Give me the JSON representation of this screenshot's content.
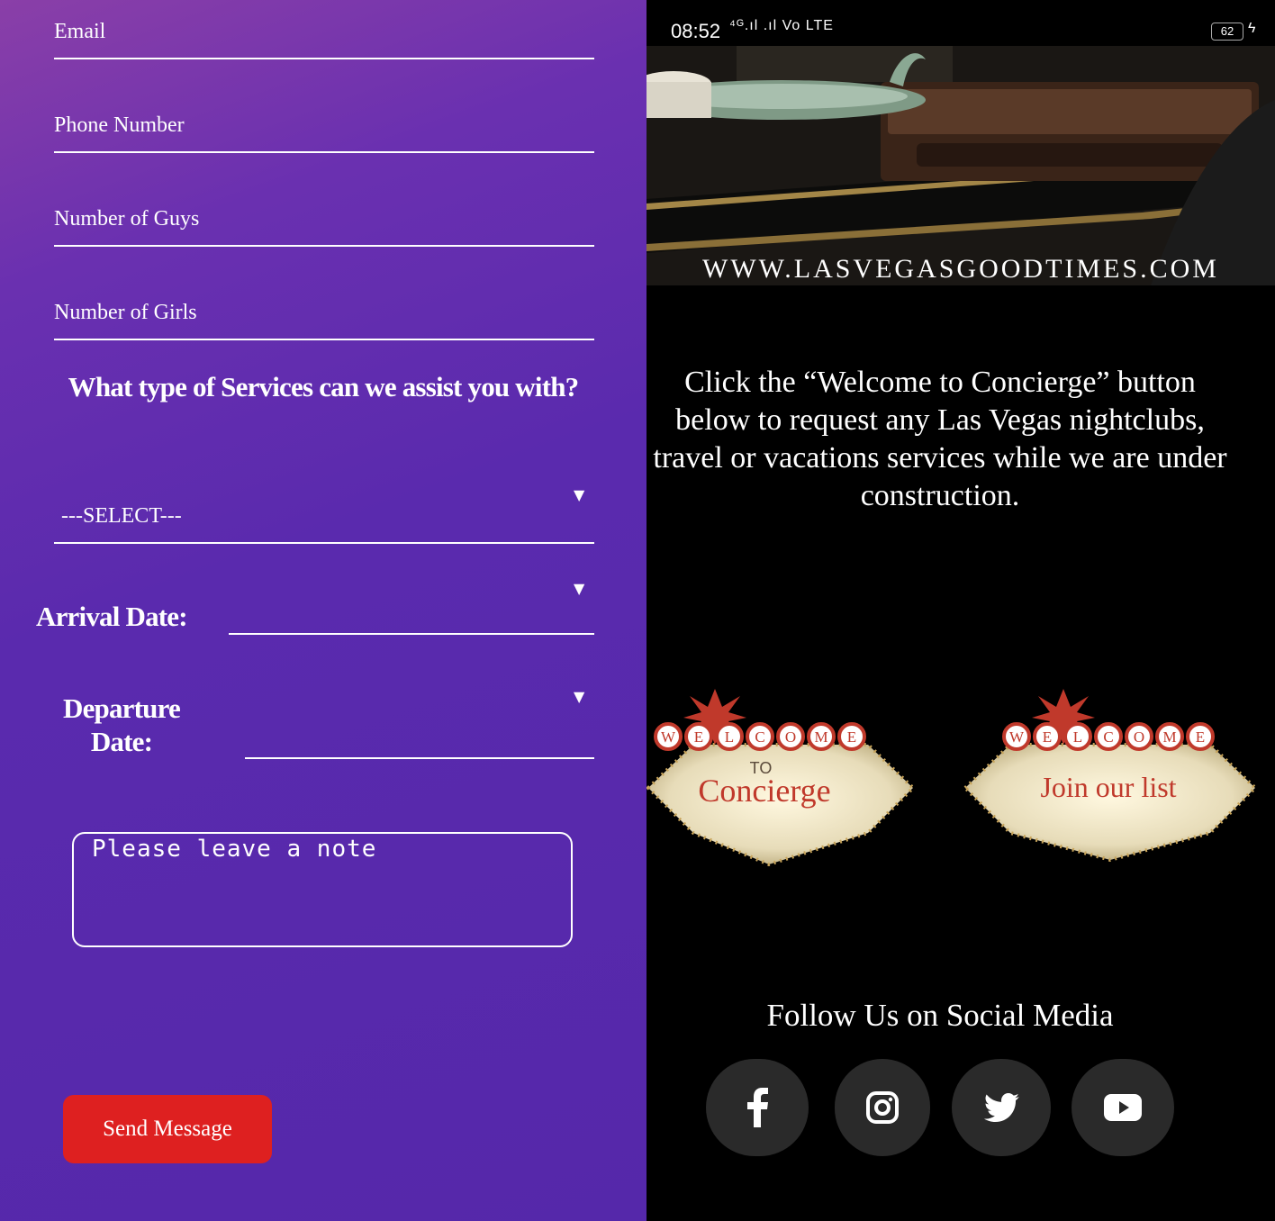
{
  "form": {
    "email_placeholder": "Email",
    "phone_placeholder": "Phone Number",
    "guys_placeholder": "Number of Guys",
    "girls_placeholder": "Number of Girls",
    "services_question": "What type of Services can we assist you with?",
    "services_select_value": "---SELECT---",
    "arrival_label": "Arrival Date:",
    "departure_label_line1": "Departure",
    "departure_label_line2": "Date:",
    "note_placeholder": "Please leave a note",
    "send_button": "Send Message"
  },
  "status_bar": {
    "time": "08:52",
    "network": "⁴ᴳ.ıl .ıl Vo LTE",
    "battery": "62"
  },
  "site": {
    "url": "WWW.LASVEGASGOODTIMES.COM",
    "message": "Click the “Welcome to Concierge” button below to request any Las Vegas nightclubs, travel or vacations services while we are under construction.",
    "concierge_sign": {
      "welcome_letters": [
        "W",
        "E",
        "L",
        "C",
        "O",
        "M",
        "E"
      ],
      "small": "TO",
      "main": "Concierge"
    },
    "join_sign": {
      "welcome_letters": [
        "W",
        "E",
        "L",
        "C",
        "O",
        "M",
        "E"
      ],
      "main": "Join our list"
    },
    "follow_heading": "Follow Us on Social Media",
    "social_icons": [
      "facebook-icon",
      "instagram-icon",
      "twitter-icon",
      "youtube-icon"
    ]
  },
  "colors": {
    "form_background": "#5a2aae",
    "send_button": "#de2020",
    "sign_text": "#c0392b"
  }
}
